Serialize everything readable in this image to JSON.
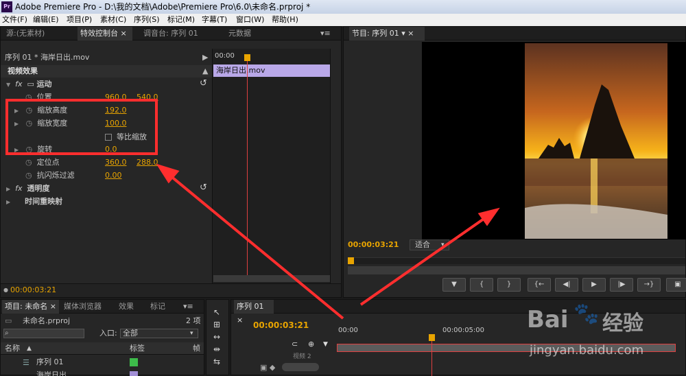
{
  "window": {
    "title": "Adobe Premiere Pro - D:\\我的文档\\Adobe\\Premiere Pro\\6.0\\未命名.prproj *",
    "logo": "Pr"
  },
  "menu": [
    "文件(F)",
    "编辑(E)",
    "项目(P)",
    "素材(C)",
    "序列(S)",
    "标记(M)",
    "字幕(T)",
    "窗口(W)",
    "帮助(H)"
  ],
  "top_tabs": {
    "source": "源:(无素材)",
    "effect_controls": "特效控制台",
    "mixer": "调音台: 序列 01",
    "metadata": "元数据"
  },
  "effect_controls": {
    "clip": "序列 01 * 海岸日出.mov",
    "timeline_time": "00:00",
    "clip_bar": "海岸日出.mov",
    "section": "视频效果",
    "motion": "运动",
    "position_label": "位置",
    "position_x": "960.0",
    "position_y": "540.0",
    "scale_h_label": "缩放高度",
    "scale_h": "192.0",
    "scale_w_label": "缩放宽度",
    "scale_w": "100.0",
    "uniform_label": "等比缩放",
    "rotation_label": "旋转",
    "rotation": "0.0",
    "anchor_label": "定位点",
    "anchor_x": "360.0",
    "anchor_y": "288.0",
    "flicker_label": "抗闪烁过滤",
    "flicker": "0.00",
    "opacity": "透明度",
    "time_remap": "时间重映射",
    "current_time": "00:00:03:21"
  },
  "program": {
    "tab": "节目: 序列 01",
    "timecode": "00:00:03:21",
    "fit": "适合"
  },
  "project": {
    "tabs": [
      "项目: 未命名",
      "媒体浏览器",
      "效果",
      "标记"
    ],
    "file": "未命名.prproj",
    "count": "2 项",
    "search_placeholder": "",
    "in_label": "入口:",
    "in_value": "全部",
    "col_name": "名称",
    "col_label": "标签",
    "col_frame": "帧",
    "items": [
      {
        "name": "序列 01",
        "color": "#3dbb4a"
      },
      {
        "name": "海岸日出",
        "color": "#a28fd6"
      }
    ]
  },
  "sequence": {
    "tab": "序列 01",
    "timecode": "00:00:03:21",
    "ruler_start": "00:00",
    "ruler_mid": "00:00:05:00",
    "track": "视频 2"
  },
  "watermark": {
    "brand": "Bai",
    "brand2": "经验",
    "url": "jingyan.baidu.com"
  },
  "colors": {
    "accent": "#e8a400",
    "annotation": "#ff2e2e",
    "clip": "#b9a8e8"
  }
}
